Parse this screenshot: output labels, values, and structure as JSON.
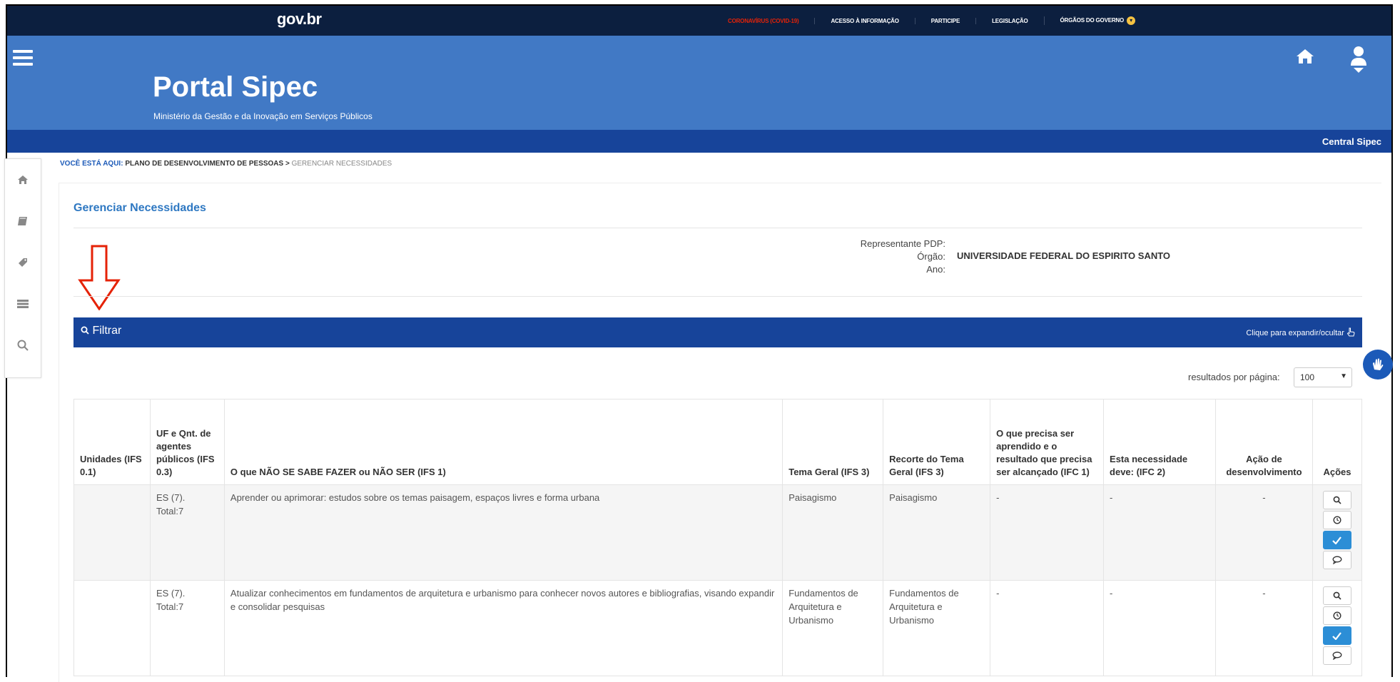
{
  "govbar": {
    "logo": "gov.br",
    "menu": [
      "CORONAVÍRUS (COVID-19)",
      "ACESSO À INFORMAÇÃO",
      "PARTICIPE",
      "LEGISLAÇÃO",
      "ÓRGÃOS DO GOVERNO"
    ]
  },
  "header": {
    "title": "Portal Sipec",
    "subtitle": "Ministério da Gestão e da Inovação em Serviços Públicos",
    "central": "Central Sipec"
  },
  "breadcrumb": {
    "prefix": "VOCÊ ESTÁ AQUI:",
    "level1": "PLANO DE DESENVOLVIMENTO DE PESSOAS >",
    "level2": "GERENCIAR NECESSIDADES"
  },
  "page": {
    "title": "Gerenciar Necessidades",
    "labels": {
      "representante": "Representante PDP:",
      "orgao": "Órgão:",
      "ano": "Ano:"
    },
    "orgao_value": "UNIVERSIDADE FEDERAL DO ESPIRITO SANTO"
  },
  "filter": {
    "label": "Filtrar",
    "toggle": "Clique para expandir/ocultar"
  },
  "pagination": {
    "label": "resultados por página:",
    "value": "100"
  },
  "table": {
    "headers": [
      "Unidades (IFS 0.1)",
      "UF e Qnt. de agentes públicos (IFS 0.3)",
      "O que NÃO SE SABE FAZER ou NÃO SER (IFS 1)",
      "Tema Geral (IFS 3)",
      "Recorte do Tema Geral (IFS 3)",
      "O que precisa ser aprendido e o resultado que precisa ser alcançado (IFC 1)",
      "Esta necessidade deve: (IFC 2)",
      "Ação de desenvolvimento",
      "Ações"
    ],
    "rows": [
      {
        "unidades": "",
        "uf_line1": "ES (7).",
        "uf_line2": "Total:7",
        "nao_sabe": "Aprender ou aprimorar: estudos sobre os temas paisagem, espaços livres e forma urbana",
        "tema": "Paisagismo",
        "recorte": "Paisagismo",
        "aprendido": "-",
        "necessidade": "-",
        "acao": "-"
      },
      {
        "unidades": "",
        "uf_line1": "ES (7).",
        "uf_line2": "Total:7",
        "nao_sabe": "Atualizar conhecimentos em fundamentos de arquitetura e urbanismo para conhecer novos autores e bibliografias, visando expandir e consolidar pesquisas",
        "tema": "Fundamentos de Arquitetura e Urbanismo",
        "recorte": "Fundamentos de Arquitetura e Urbanismo",
        "aprendido": "-",
        "necessidade": "-",
        "acao": "-"
      }
    ]
  },
  "colors": {
    "govbar": "#0c1f3f",
    "header": "#4179c5",
    "subbar": "#17449a",
    "accent_title": "#2e78c2",
    "annotation_arrow": "#e52207"
  }
}
